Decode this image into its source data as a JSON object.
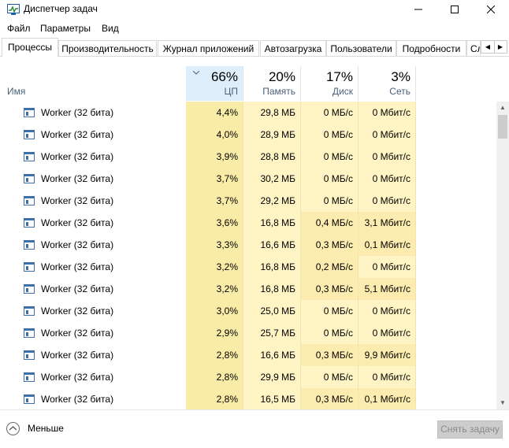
{
  "window": {
    "title": "Диспетчер задач",
    "buttons": [
      "minimize",
      "maximize",
      "close"
    ]
  },
  "menu": [
    "Файл",
    "Параметры",
    "Вид"
  ],
  "tabs": [
    {
      "label": "Процессы",
      "active": true
    },
    {
      "label": "Производительность"
    },
    {
      "label": "Журнал приложений"
    },
    {
      "label": "Автозагрузка"
    },
    {
      "label": "Пользователи"
    },
    {
      "label": "Подробности"
    },
    {
      "label": "Сл"
    }
  ],
  "columns": {
    "name": "Имя",
    "cpu": {
      "percent": "66%",
      "label": "ЦП"
    },
    "memory": {
      "percent": "20%",
      "label": "Память"
    },
    "disk": {
      "percent": "17%",
      "label": "Диск"
    },
    "network": {
      "percent": "3%",
      "label": "Сеть"
    }
  },
  "processes": [
    {
      "name": "Worker (32 бита)",
      "cpu": "4,4%",
      "memory": "29,8 МБ",
      "disk": "0 МБ/с",
      "network": "0 Мбит/с"
    },
    {
      "name": "Worker (32 бита)",
      "cpu": "4,0%",
      "memory": "28,9 МБ",
      "disk": "0 МБ/с",
      "network": "0 Мбит/с"
    },
    {
      "name": "Worker (32 бита)",
      "cpu": "3,9%",
      "memory": "28,8 МБ",
      "disk": "0 МБ/с",
      "network": "0 Мбит/с"
    },
    {
      "name": "Worker (32 бита)",
      "cpu": "3,7%",
      "memory": "30,2 МБ",
      "disk": "0 МБ/с",
      "network": "0 Мбит/с"
    },
    {
      "name": "Worker (32 бита)",
      "cpu": "3,7%",
      "memory": "29,2 МБ",
      "disk": "0 МБ/с",
      "network": "0 Мбит/с"
    },
    {
      "name": "Worker (32 бита)",
      "cpu": "3,6%",
      "memory": "16,8 МБ",
      "disk": "0,4 МБ/с",
      "network": "3,1 Мбит/с"
    },
    {
      "name": "Worker (32 бита)",
      "cpu": "3,3%",
      "memory": "16,6 МБ",
      "disk": "0,3 МБ/с",
      "network": "0,1 Мбит/с"
    },
    {
      "name": "Worker (32 бита)",
      "cpu": "3,2%",
      "memory": "16,8 МБ",
      "disk": "0,2 МБ/с",
      "network": "0 Мбит/с"
    },
    {
      "name": "Worker (32 бита)",
      "cpu": "3,2%",
      "memory": "16,8 МБ",
      "disk": "0,3 МБ/с",
      "network": "5,1 Мбит/с"
    },
    {
      "name": "Worker (32 бита)",
      "cpu": "3,0%",
      "memory": "25,0 МБ",
      "disk": "0 МБ/с",
      "network": "0 Мбит/с"
    },
    {
      "name": "Worker (32 бита)",
      "cpu": "2,9%",
      "memory": "25,7 МБ",
      "disk": "0 МБ/с",
      "network": "0 Мбит/с"
    },
    {
      "name": "Worker (32 бита)",
      "cpu": "2,8%",
      "memory": "16,6 МБ",
      "disk": "0,3 МБ/с",
      "network": "9,9 Мбит/с"
    },
    {
      "name": "Worker (32 бита)",
      "cpu": "2,8%",
      "memory": "29,9 МБ",
      "disk": "0 МБ/с",
      "network": "0 Мбит/с"
    },
    {
      "name": "Worker (32 бита)",
      "cpu": "2,8%",
      "memory": "16,5 МБ",
      "disk": "0,3 МБ/с",
      "network": "0,1 Мбит/с"
    }
  ],
  "footer": {
    "less_label": "Меньше",
    "end_task_label": "Снять задачу"
  },
  "colors": {
    "cpu_heat": "#f9eca8",
    "heat_light": "#fff4c4",
    "heat_medium": "#fcecb0",
    "header_highlight": "#deeefa",
    "header_label": "#4c607a"
  }
}
